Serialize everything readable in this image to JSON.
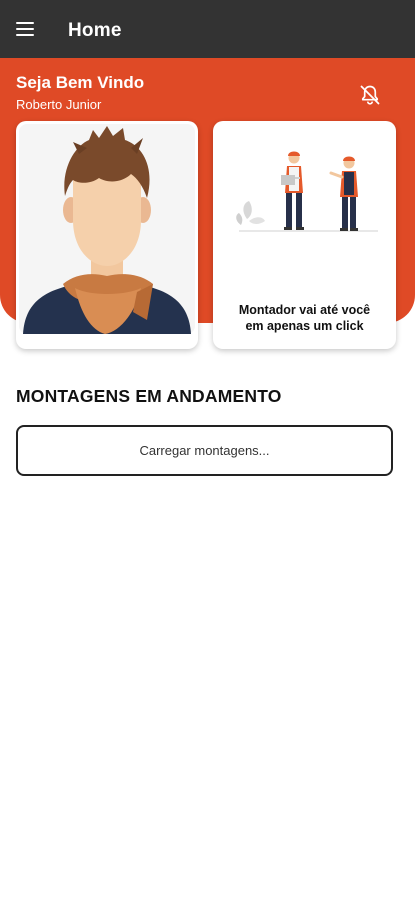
{
  "appbar": {
    "title": "Home",
    "menu_icon": "menu-icon"
  },
  "header": {
    "greeting": "Seja Bem Vindo",
    "user_name": "Roberto Junior",
    "notification_icon": "bell-off-icon",
    "background_color": "#df4a26"
  },
  "cards": {
    "avatar": {
      "image": "user-avatar-illustration"
    },
    "promo": {
      "image": "workers-illustration",
      "line1": "Montador vai até você",
      "line2": "em apenas um click"
    }
  },
  "section": {
    "title": "MONTAGENS EM ANDAMENTO"
  },
  "load_button": {
    "label": "Carregar montagens..."
  }
}
